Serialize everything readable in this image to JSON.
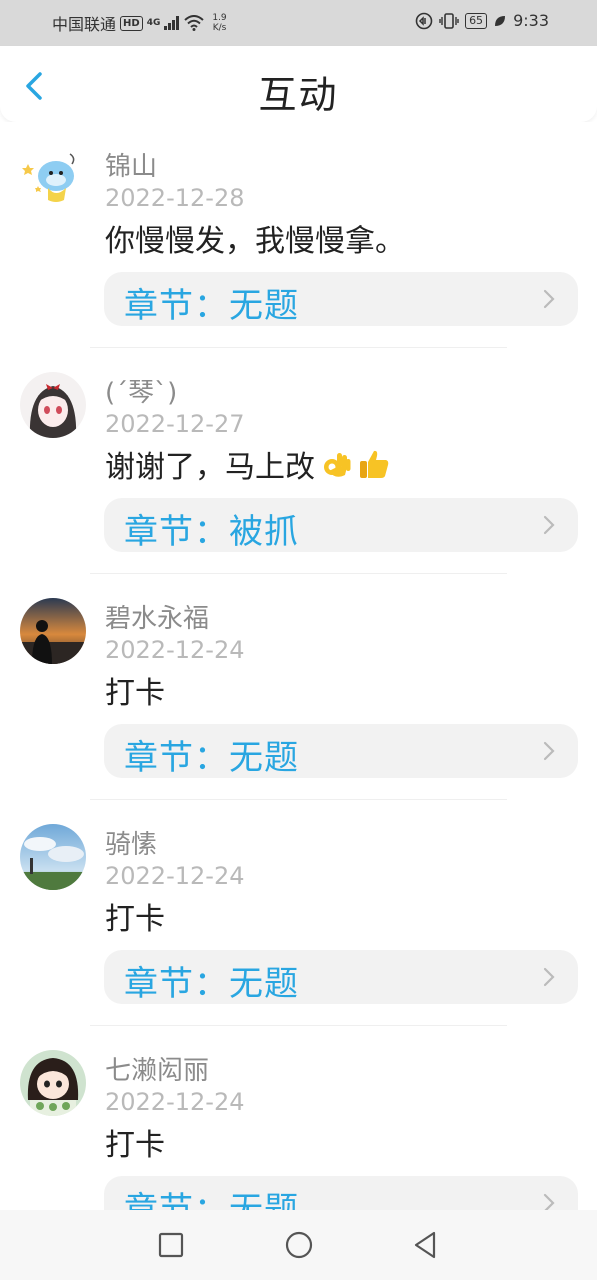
{
  "status_bar": {
    "carrier": "中国联通",
    "hd": "HD",
    "network": "4G",
    "speed_value": "1.9",
    "speed_unit": "K/s",
    "battery": "65",
    "time": "9:33"
  },
  "header": {
    "title": "互动",
    "back_icon": "chevron-left-icon"
  },
  "comments": [
    {
      "name": "锦山",
      "date": "2022-12-28",
      "content": "你慢慢发，我慢慢拿。",
      "chapter": "章节：无题",
      "avatar": "cartoon-cow-avatar"
    },
    {
      "name": "(ˊ琴ˋ)",
      "date": "2022-12-27",
      "content": "谢谢了，马上改",
      "emojis": [
        "ok-hand-emoji",
        "thumbs-up-emoji"
      ],
      "chapter": "章节：被抓",
      "avatar": "anime-girl-avatar"
    },
    {
      "name": "碧水永福",
      "date": "2022-12-24",
      "content": "打卡",
      "chapter": "章节：无题",
      "avatar": "sunset-silhouette-avatar"
    },
    {
      "name": "骑愫",
      "date": "2022-12-24",
      "content": "打卡",
      "chapter": "章节：无题",
      "avatar": "sky-landscape-avatar"
    },
    {
      "name": "七濑闳丽",
      "date": "2022-12-24",
      "content": "打卡",
      "chapter": "章节：无题",
      "avatar": "chibi-girl-avatar"
    }
  ],
  "colors": {
    "accent": "#29a6e1",
    "chapter_bg": "#f2f2f2",
    "status_bar_bg": "#d9d9d9"
  },
  "navbar": {
    "buttons": [
      "recent-apps-icon",
      "home-icon",
      "back-triangle-icon"
    ]
  }
}
